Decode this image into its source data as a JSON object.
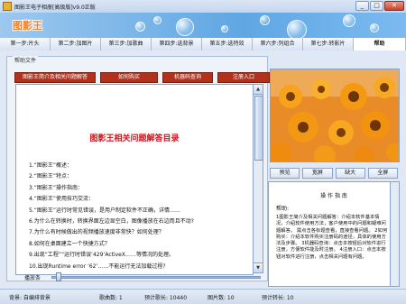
{
  "window": {
    "title": "图影王电子相册[高级版]v9.0正版"
  },
  "banner": {
    "logo_text": "图影王"
  },
  "tabs": [
    {
      "label": "第一步:片头"
    },
    {
      "label": "第二步:加图片"
    },
    {
      "label": "第三步:加歌曲"
    },
    {
      "label": "第四步:选背景"
    },
    {
      "label": "第五步:选特效"
    },
    {
      "label": "第六步:列组合"
    },
    {
      "label": "第七步:转影片"
    },
    {
      "label": "帮助"
    }
  ],
  "main": {
    "legend": "帮助文件",
    "buttons": [
      "图影王简介及相关问题解答",
      "如何购买",
      "机器码查询",
      "注册入口"
    ],
    "doc_title": "图影王相关问题解答目录",
    "doc_items": [
      "1.“图影王”概述：",
      "2.“图影王”特点：",
      "3.“图影王”操作指南：",
      "4.“图影王”使用技巧交流：",
      "5.“图影王”运行时常见错误，是用户制定软件不正确，详情……",
      "6.为什么在转换时，转换界面左边显空白，图像播放在右边而且不动?",
      "7.为什么有时候做出的视频播放速度非常快？如何处理？",
      "8.如何在桌面建立一个快捷方式？",
      "9.出现“工程”“运行时错误‘429’ActiveX……等情况的处理。",
      "10.出现Runtime error ‘62’……不能运行无法加载过程?"
    ]
  },
  "slider": {
    "label": "播放条"
  },
  "status": {
    "name_label": "背景: 自编排背景",
    "music_label": "歌曲数: 1",
    "count_label": "预计歌长: 10440",
    "pictures_label": "图片数: 10",
    "time_label": "预计转长: 10"
  },
  "preview": {
    "controls": [
      "预览",
      "宽屏",
      "缺大",
      "全屏"
    ]
  },
  "guide": {
    "title": "操 作 指 南",
    "label": "帮助:",
    "text": "1图影王简介及相关问题解答：介绍本软件基本情况，介绍软件使用方法，客户使用中的问题和疑难问题解答。 需点击各标题查看，直接查看问题。 2如何购买：介绍本软件购买注册码的途径，具体的使用方法及步骤。 3机器码查询：点击本按钮后对软件进行注册，方便软件能及时注册。 4注册入口：点击本按钮对软件进行注册，点击相关问题有问题。"
  },
  "colors": {
    "accent_red": "#b3311b",
    "title_red": "#d0131a",
    "banner_blue": "#5fa7e4",
    "logo_orange": "#ff7a1a"
  }
}
